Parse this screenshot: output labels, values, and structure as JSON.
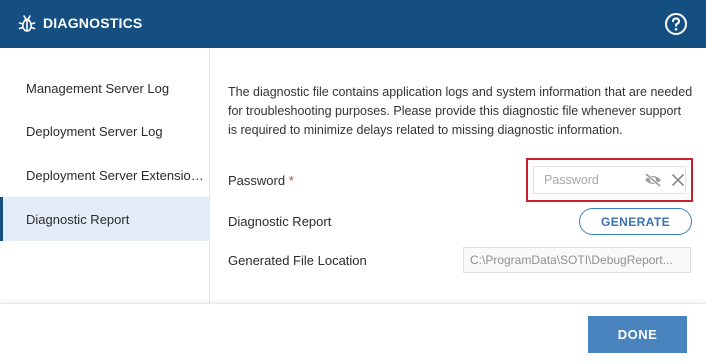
{
  "header": {
    "title": "DIAGNOSTICS",
    "icon": "bug-icon",
    "help_icon": "help-circle-icon",
    "background": "#154e80"
  },
  "sidebar": {
    "items": [
      {
        "label": "Management Server Log",
        "active": false
      },
      {
        "label": "Deployment Server Log",
        "active": false
      },
      {
        "label": "Deployment Server Extension Log",
        "active": false
      },
      {
        "label": "Diagnostic Report",
        "active": true
      }
    ]
  },
  "main": {
    "description": "The diagnostic file contains application logs and system information that are needed for troubleshooting purposes. Please provide this diagnostic file whenever support is required to minimize delays related to missing diagnostic information.",
    "password_label": "Password",
    "required_marker": "*",
    "password_placeholder": "Password",
    "password_value": "",
    "report_label": "Diagnostic Report",
    "generate_label": "GENERATE",
    "location_label": "Generated File Location",
    "location_value": "C:\\ProgramData\\SOTI\\DebugReport..."
  },
  "footer": {
    "done_label": "DONE"
  },
  "colors": {
    "accent": "#4a84bf",
    "highlight_box": "#c8202f",
    "active_nav_bg": "#e3edf7"
  }
}
